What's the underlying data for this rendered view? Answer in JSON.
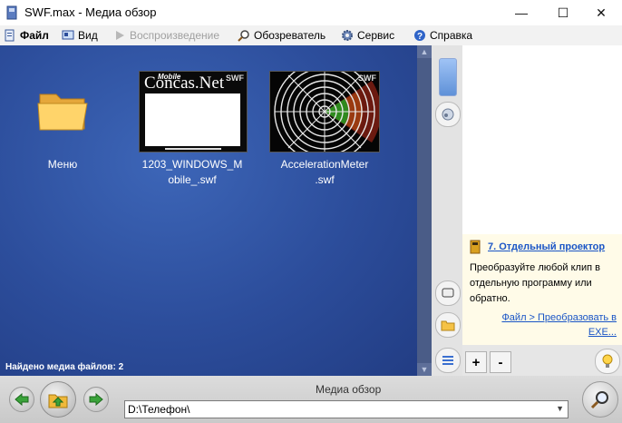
{
  "window": {
    "title": "SWF.max - Медиа обзор",
    "minimize": "—",
    "maximize": "☐",
    "close": "✕"
  },
  "menu": [
    {
      "label": "Файл",
      "icon": "document-icon",
      "bold": true,
      "disabled": false
    },
    {
      "label": "Вид",
      "icon": "view-icon",
      "bold": false,
      "disabled": false
    },
    {
      "label": "Воспроизведение",
      "icon": "play-icon",
      "bold": false,
      "disabled": true
    },
    {
      "label": "Обозреватель",
      "icon": "magnifier-icon",
      "bold": false,
      "disabled": false
    },
    {
      "label": "Сервис",
      "icon": "gear-icon",
      "bold": false,
      "disabled": false
    },
    {
      "label": "Справка",
      "icon": "help-icon",
      "bold": false,
      "disabled": false
    }
  ],
  "files": [
    {
      "label": "Меню",
      "type": "folder"
    },
    {
      "label_line1": "1203_WINDOWS_M",
      "label_line2": "obile_.swf",
      "thumb_text_small": "Mobile",
      "thumb_text_big": "Concas.Net",
      "thumb_badge": "SWF"
    },
    {
      "label_line1": "AccelerationMeter",
      "label_line2": ".swf",
      "thumb_badge": "SWF"
    }
  ],
  "status": "Найдено медиа файлов: 2",
  "tip": {
    "title": "7. Отдельный проектор",
    "body": "Преобразуйте любой клип в отдельную программу или обратно.",
    "link": "Файл > Преобразовать в EXE..."
  },
  "buttons": {
    "plus": "+",
    "minus": "-"
  },
  "bottom": {
    "title": "Медиа обзор",
    "path": "D:\\Телефон\\"
  },
  "colors": {
    "panel_blue": "#2c4d9b",
    "link_blue": "#1a55c6",
    "tip_bg": "#fffbe8"
  }
}
